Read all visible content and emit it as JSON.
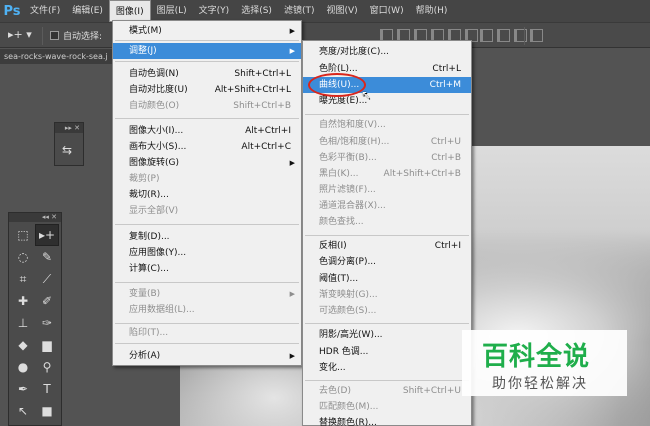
{
  "app_logo": "Ps",
  "menubar": [
    "文件(F)",
    "编辑(E)",
    "图像(I)",
    "图层(L)",
    "文字(Y)",
    "选择(S)",
    "滤镜(T)",
    "视图(V)",
    "窗口(W)",
    "帮助(H)"
  ],
  "options_bar": {
    "move_tool_glyph": "▸+ ▾",
    "auto_select_label": "自动选择:"
  },
  "document_tab": "sea-rocks-wave-rock-sea.j",
  "image_menu": [
    {
      "label": "模式(M)",
      "submenu": true
    },
    {
      "label": "调整(J)",
      "submenu": true,
      "highlighted": true
    },
    {
      "label": "自动色调(N)",
      "shortcut": "Shift+Ctrl+L"
    },
    {
      "label": "自动对比度(U)",
      "shortcut": "Alt+Shift+Ctrl+L"
    },
    {
      "label": "自动颜色(O)",
      "shortcut": "Shift+Ctrl+B",
      "disabled": true
    },
    {
      "label": "图像大小(I)...",
      "shortcut": "Alt+Ctrl+I"
    },
    {
      "label": "画布大小(S)...",
      "shortcut": "Alt+Ctrl+C"
    },
    {
      "label": "图像旋转(G)",
      "submenu": true
    },
    {
      "label": "裁剪(P)",
      "disabled": true
    },
    {
      "label": "裁切(R)..."
    },
    {
      "label": "显示全部(V)",
      "disabled": true
    },
    {
      "label": "复制(D)..."
    },
    {
      "label": "应用图像(Y)..."
    },
    {
      "label": "计算(C)..."
    },
    {
      "label": "变量(B)",
      "submenu": true,
      "disabled": true
    },
    {
      "label": "应用数据组(L)...",
      "disabled": true
    },
    {
      "label": "陷印(T)...",
      "disabled": true
    },
    {
      "label": "分析(A)",
      "submenu": true
    }
  ],
  "adjust_menu": [
    {
      "label": "亮度/对比度(C)..."
    },
    {
      "label": "色阶(L)...",
      "shortcut": "Ctrl+L"
    },
    {
      "label": "曲线(U)...",
      "shortcut": "Ctrl+M",
      "highlighted": true
    },
    {
      "label": "曝光度(E)..."
    },
    {
      "label": "自然饱和度(V)...",
      "disabled": true
    },
    {
      "label": "色相/饱和度(H)...",
      "shortcut": "Ctrl+U",
      "disabled": true
    },
    {
      "label": "色彩平衡(B)...",
      "shortcut": "Ctrl+B",
      "disabled": true
    },
    {
      "label": "黑白(K)...",
      "shortcut": "Alt+Shift+Ctrl+B",
      "disabled": true
    },
    {
      "label": "照片滤镜(F)...",
      "disabled": true
    },
    {
      "label": "通道混合器(X)...",
      "disabled": true
    },
    {
      "label": "颜色查找...",
      "disabled": true
    },
    {
      "label": "反相(I)",
      "shortcut": "Ctrl+I"
    },
    {
      "label": "色调分离(P)..."
    },
    {
      "label": "阈值(T)..."
    },
    {
      "label": "渐变映射(G)...",
      "disabled": true
    },
    {
      "label": "可选颜色(S)...",
      "disabled": true
    },
    {
      "label": "阴影/高光(W)..."
    },
    {
      "label": "HDR 色调..."
    },
    {
      "label": "变化..."
    },
    {
      "label": "去色(D)",
      "shortcut": "Shift+Ctrl+U",
      "disabled": true
    },
    {
      "label": "匹配颜色(M)...",
      "disabled": true
    },
    {
      "label": "替换颜色(R)..."
    }
  ],
  "watermark": {
    "title": "百科全说",
    "subtitle": "助你轻松解决"
  },
  "colors": {
    "menu_highlight": "#3c8cd9",
    "annotation_ring": "#d9261c",
    "watermark_green": "#1fae4b"
  }
}
